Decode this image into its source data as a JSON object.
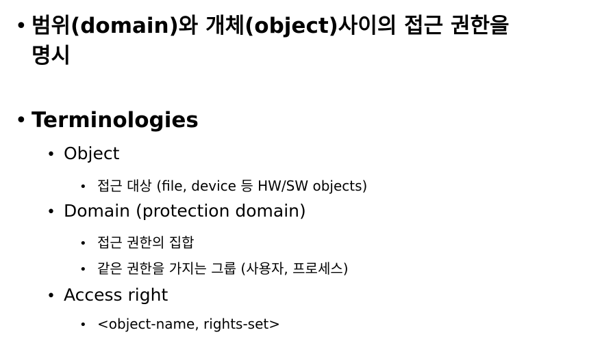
{
  "bullet_glyph": "•",
  "items": [
    {
      "level": 1,
      "text_line1": "범위(domain)와 개체(object)사이의 접근 권한을",
      "text_line2": "명시"
    },
    {
      "level": 1,
      "text": "Terminologies"
    },
    {
      "level": 2,
      "text": "Object"
    },
    {
      "level": 3,
      "text": "접근 대상 (file, device 등 HW/SW objects)"
    },
    {
      "level": 2,
      "text": "Domain (protection domain)"
    },
    {
      "level": 3,
      "text": "접근 권한의 집합"
    },
    {
      "level": 3,
      "text": "같은 권한을 가지는 그룹 (사용자, 프로세스)"
    },
    {
      "level": 2,
      "text": "Access right"
    },
    {
      "level": 3,
      "text": "<object-name, rights-set>"
    }
  ]
}
